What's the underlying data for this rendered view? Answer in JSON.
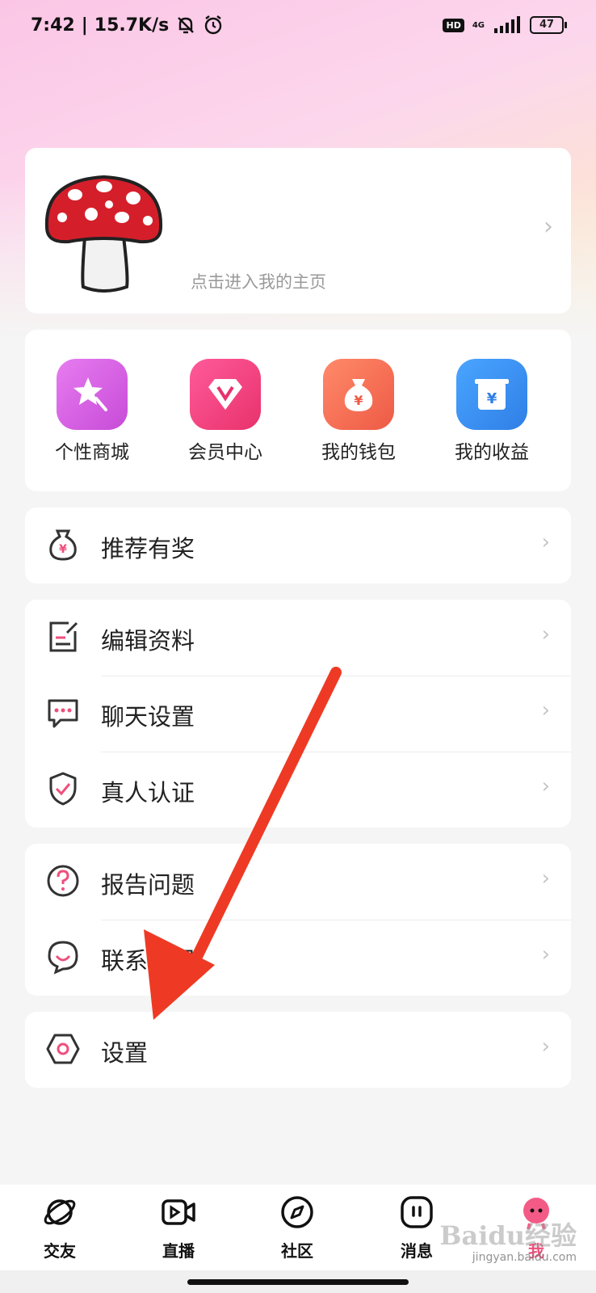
{
  "status": {
    "time": "7:42",
    "speed": "15.7K/s",
    "hd": "HD",
    "network": "4G",
    "battery": "47"
  },
  "profile": {
    "home_link": "点击进入我的主页"
  },
  "shortcuts": [
    {
      "label": "个性商城",
      "icon": "star-wand-icon",
      "color": "#d75ad6"
    },
    {
      "label": "会员中心",
      "icon": "diamond-v-icon",
      "color": "#f0417f"
    },
    {
      "label": "我的钱包",
      "icon": "money-bag-icon",
      "color": "#f56f52"
    },
    {
      "label": "我的收益",
      "icon": "earnings-box-icon",
      "color": "#3a8ff0"
    }
  ],
  "menu": {
    "reward": "推荐有奖",
    "edit_profile": "编辑资料",
    "chat_settings": "聊天设置",
    "verification": "真人认证",
    "report_issue": "报告问题",
    "contact_service": "联系客服",
    "settings": "设置"
  },
  "tabs": [
    {
      "label": "交友",
      "icon": "planet-icon"
    },
    {
      "label": "直播",
      "icon": "video-camera-icon"
    },
    {
      "label": "社区",
      "icon": "compass-icon"
    },
    {
      "label": "消息",
      "icon": "message-icon"
    },
    {
      "label": "我",
      "icon": "profile-character-icon"
    }
  ],
  "watermark": {
    "brand": "Baidu经验",
    "url": "jingyan.baidu.com"
  },
  "accent_color": "#ef4f7c"
}
